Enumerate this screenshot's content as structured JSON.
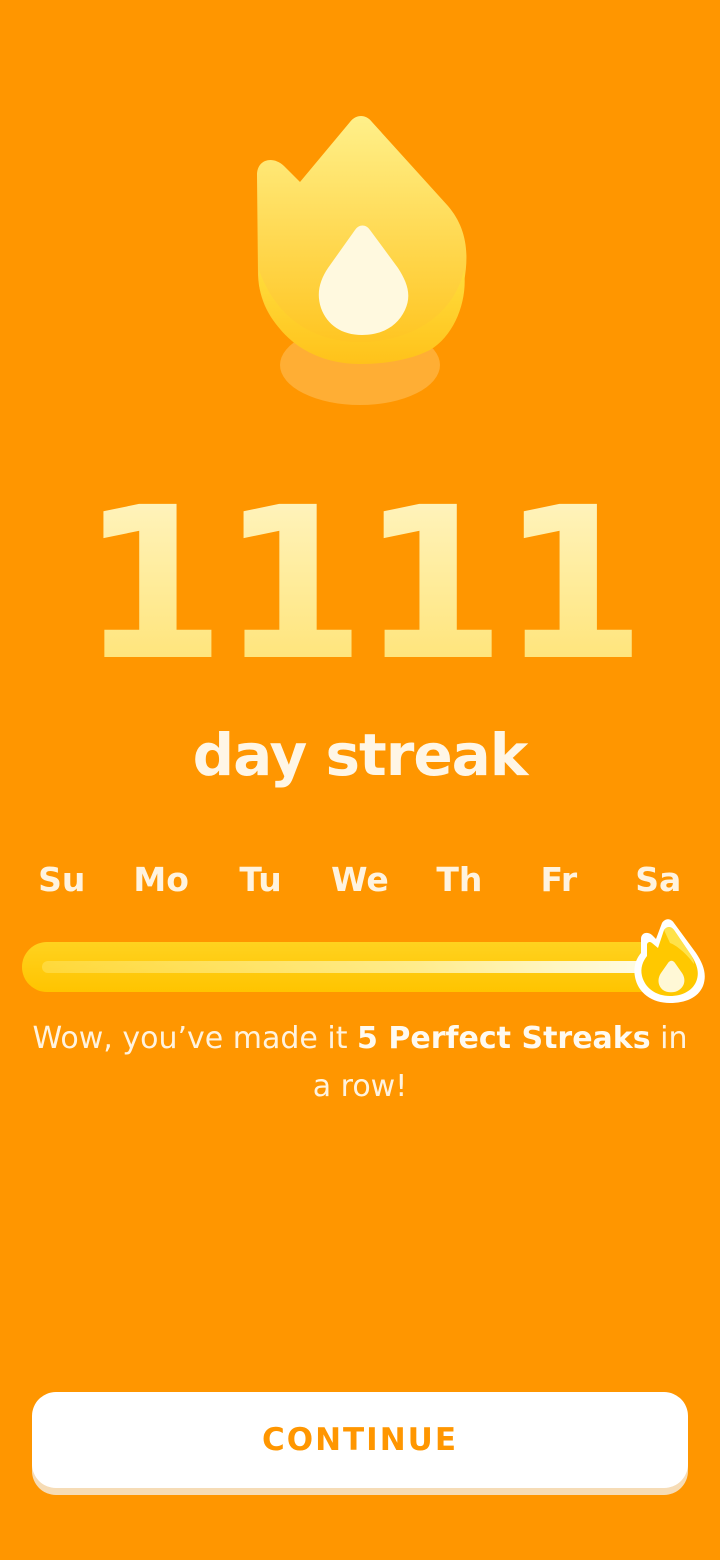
{
  "streak": {
    "count": "1111",
    "label": "day streak"
  },
  "week": {
    "days": [
      "Su",
      "Mo",
      "Tu",
      "We",
      "Th",
      "Fr",
      "Sa"
    ],
    "progress_fraction": 1.0
  },
  "message": {
    "prefix": "Wow, you’ve made it ",
    "highlight": "5 Perfect Streaks",
    "suffix": " in a row!"
  },
  "continue_button": {
    "label": "CONTINUE"
  },
  "colors": {
    "background": "#ff9600",
    "flame_top": "#ffe97a",
    "flame_bottom": "#ffc21a",
    "flame_core": "#fff9df",
    "track": "#ffc800",
    "button_text": "#ff9600"
  },
  "icons": {
    "hero": "streak-flame-icon",
    "marker": "flame-marker-icon"
  }
}
